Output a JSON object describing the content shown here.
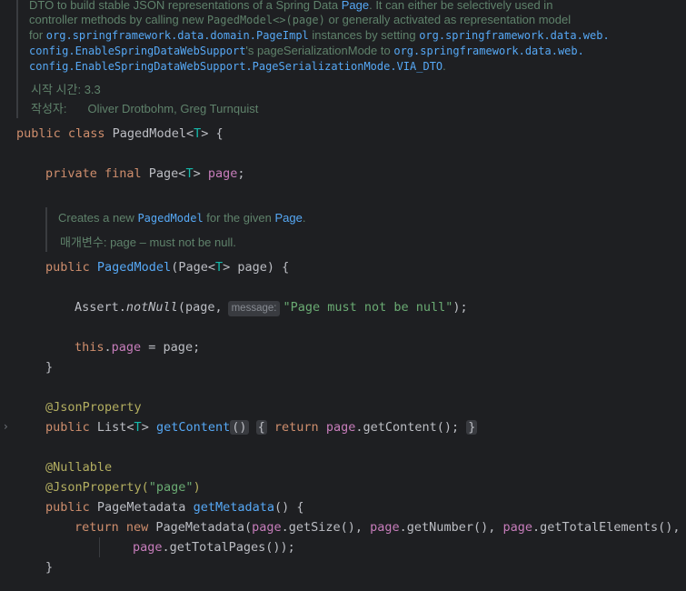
{
  "top_doc": {
    "l1_a": "DTO to build stable JSON representations of a Spring Data ",
    "l1_page": "Page",
    "l1_b": ". It can either be selectively used in",
    "l2_a": "controller methods by calling new ",
    "l2_code": "PagedModel<>(page)",
    "l2_b": " or generally activated as representation model",
    "l3_a": "for ",
    "l3_code1": "org.springframework.data.domain.PageImpl",
    "l3_b": " instances by setting ",
    "l3_code2": "org.springframework.data.web.",
    "l4_code1": "config.EnableSpringDataWebSupport",
    "l4_a": "'s pageSerializationMode to ",
    "l4_code2": "org.springframework.data.web.",
    "l5_code": "config.EnableSpringDataWebSupport.PageSerializationMode.VIA_DTO",
    "l5_b": ".",
    "since_label": "시작 시간:",
    "since_value": "3.3",
    "author_label": "작성자:",
    "author_value": "Oliver Drotbohm, Greg Turnquist"
  },
  "ctor_doc": {
    "a": "Creates a new ",
    "link1": "PagedModel",
    "b": " for the given ",
    "link2": "Page",
    "c": ".",
    "param_label": "매개변수:",
    "param_text": "page – must not be null."
  },
  "code": {
    "class_kw": "public class ",
    "class_name": "PagedModel<",
    "type_param": "T",
    "class_tail": "> {",
    "field_mods": "private final ",
    "field_type": "Page<",
    "field_type_param": "T",
    "field_type_tail": "> ",
    "field_name": "page",
    "field_semi": ";",
    "ctor_public": "public ",
    "ctor_name": "PagedModel",
    "ctor_params": "(Page<",
    "ctor_params_t": "T",
    "ctor_params_tail": "> page) {",
    "assert_a": "Assert.",
    "assert_fn": "notNull",
    "assert_b": "(page,",
    "hint_label": "message:",
    "assert_str": "\"Page must not be null\"",
    "assert_c": ");",
    "this_kw": "this",
    "this_dot": ".",
    "this_field": "page",
    "this_rest": " = page;",
    "close_brace": "}",
    "ann_json": "@JsonProperty",
    "gc_public": "public ",
    "gc_type": "List<",
    "gc_t": "T",
    "gc_tail": "> ",
    "gc_name": "getContent",
    "gc_parens": "()",
    "gc_open": "{",
    "gc_return": " return ",
    "gc_field": "page",
    "gc_call": ".getContent();",
    "gc_close": "}",
    "ann_nullable": "@Nullable",
    "ann_json2": "@JsonProperty(",
    "ann_json2_str": "\"page\"",
    "ann_json2_close": ")",
    "gm_public": "public ",
    "gm_type": "PageMetadata ",
    "gm_name": "getMetadata",
    "gm_tail": "() {",
    "ret_kw": "return ",
    "new_kw": "new ",
    "ret_a": "PageMetadata(",
    "ret_f1": "page",
    "ret_b": ".getSize(), ",
    "ret_f2": "page",
    "ret_c": ".getNumber(), ",
    "ret_f3": "page",
    "ret_d": ".getTotalElements(),",
    "ret_f4": "page",
    "ret_e": ".getTotalPages());",
    "gm_close": "}"
  },
  "gutter": {
    "fold_icon": "chevron-right-icon"
  }
}
